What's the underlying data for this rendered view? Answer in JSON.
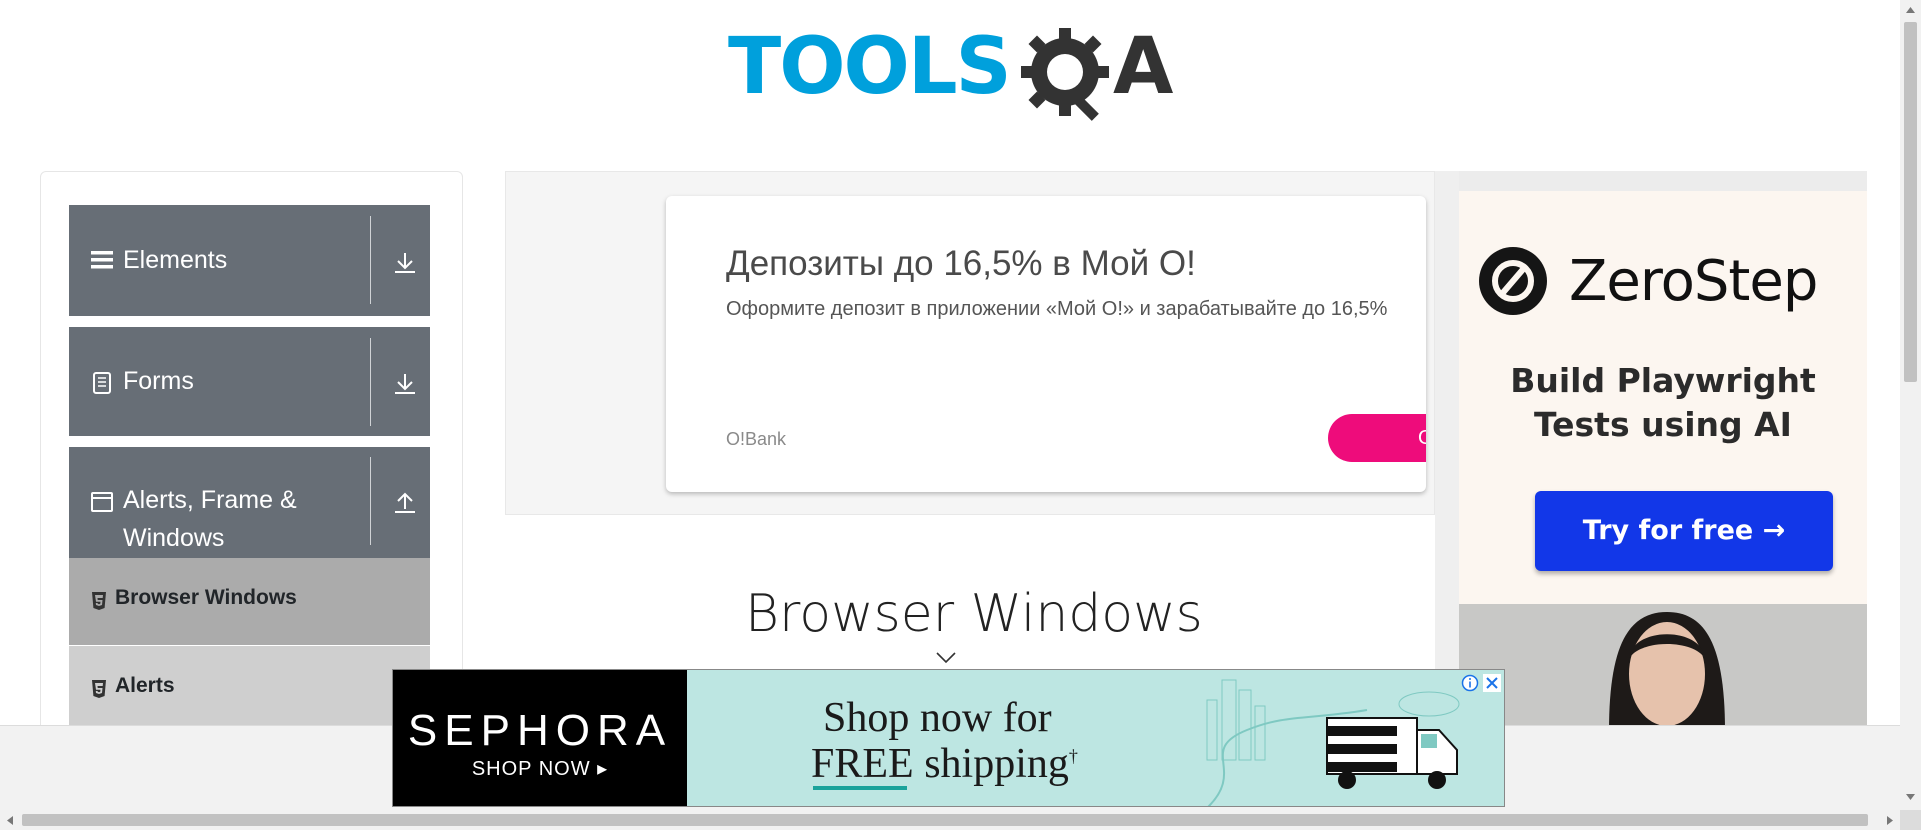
{
  "logo": {
    "text_tools": "TOOLS",
    "text_a": "A"
  },
  "nav": {
    "groups": [
      {
        "title": "Elements",
        "icon": "hamburger-icon",
        "arrow": "download-arrow-icon"
      },
      {
        "title": "Forms",
        "icon": "document-icon",
        "arrow": "download-arrow-icon"
      },
      {
        "title": "Alerts, Frame & Windows",
        "icon": "window-icon",
        "arrow": "upload-arrow-icon"
      }
    ],
    "items": [
      {
        "label": "Browser Windows",
        "icon": "html5-icon",
        "active": true
      },
      {
        "label": "Alerts",
        "icon": "html5-icon",
        "active": false
      }
    ]
  },
  "top_ad": {
    "title": "Депозиты до 16,5% в Мой О!",
    "description": "Оформите депозит в приложении «Мой О!» и зарабатывайте до 16,5%",
    "brand": "O!Bank",
    "button": "О",
    "button_color": "#ee0c7b"
  },
  "side_ad": {
    "brand": "ZeroStep",
    "headline": "Build Playwright Tests using AI",
    "button": "Try for free →",
    "button_color": "#1237e8"
  },
  "page": {
    "title": "Browser Windows"
  },
  "bottom_ad": {
    "brand": "SEPHORA",
    "shop_now": "SHOP NOW ▸",
    "line1": "Shop now for",
    "line2_free": "FREE",
    "line2_rest": " shipping",
    "dagger": "†"
  },
  "colors": {
    "nav_group_bg": "#676e76",
    "active_item_bg": "#ababab",
    "item_bg": "#cfcfcf",
    "logo_blue": "#00a0dc"
  }
}
